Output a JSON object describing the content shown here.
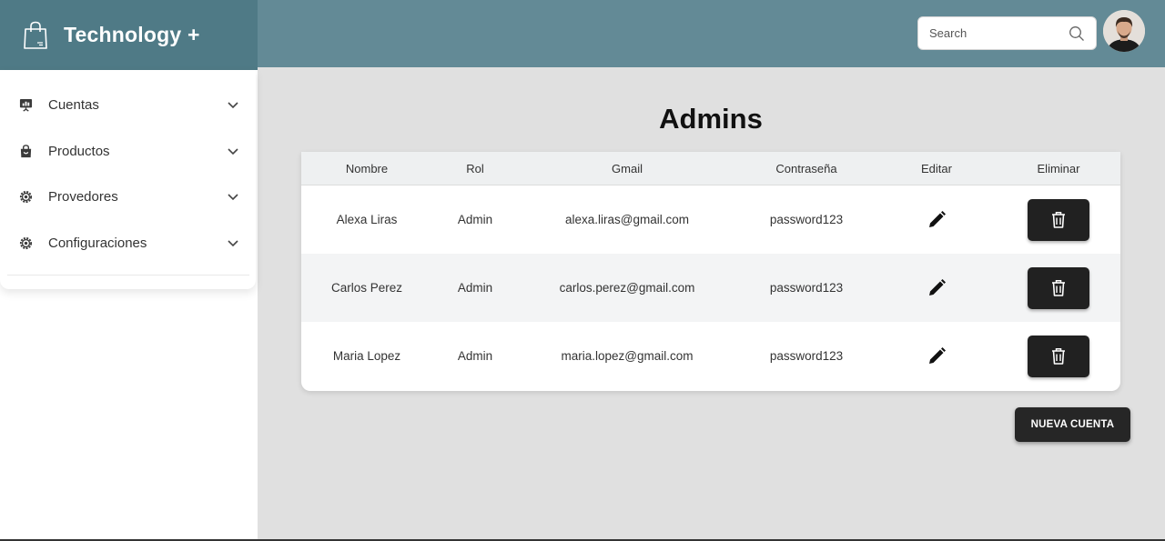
{
  "brand": {
    "title": "Technology +",
    "icon": "shopping-bag-icon",
    "bg_color": "#4f7a86"
  },
  "sidebar": {
    "items": [
      {
        "label": "Cuentas",
        "icon": "presentation-chart-icon"
      },
      {
        "label": "Productos",
        "icon": "shopping-bag-icon"
      },
      {
        "label": "Provedores",
        "icon": "gear-icon"
      },
      {
        "label": "Configuraciones",
        "icon": "gear-icon"
      }
    ]
  },
  "header": {
    "bg_color": "#638a96",
    "search": {
      "placeholder": "Search",
      "value": ""
    },
    "avatar": "user-avatar"
  },
  "main": {
    "title": "Admins",
    "table": {
      "columns": [
        "Nombre",
        "Rol",
        "Gmail",
        "Contraseña",
        "Editar",
        "Eliminar"
      ],
      "rows": [
        {
          "nombre": "Alexa Liras",
          "rol": "Admin",
          "gmail": "alexa.liras@gmail.com",
          "password": "password123"
        },
        {
          "nombre": "Carlos Perez",
          "rol": "Admin",
          "gmail": "carlos.perez@gmail.com",
          "password": "password123"
        },
        {
          "nombre": "Maria Lopez",
          "rol": "Admin",
          "gmail": "maria.lopez@gmail.com",
          "password": "password123"
        }
      ]
    },
    "new_button": "NUEVA CUENTA"
  },
  "colors": {
    "dark_button": "#212121",
    "page_bg": "#e0e0e0"
  }
}
